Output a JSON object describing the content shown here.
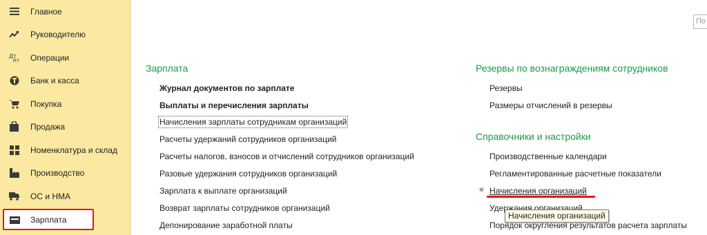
{
  "sidebar": {
    "items": [
      {
        "label": "Главное",
        "icon": "menu-lines-icon"
      },
      {
        "label": "Руководителю",
        "icon": "trend-line-icon"
      },
      {
        "label": "Операции",
        "icon": "debit-credit-icon"
      },
      {
        "label": "Банк и касса",
        "icon": "coin-icon"
      },
      {
        "label": "Покупка",
        "icon": "cart-icon"
      },
      {
        "label": "Продажа",
        "icon": "bag-icon"
      },
      {
        "label": "Номенклатура и склад",
        "icon": "grid-icon"
      },
      {
        "label": "Производство",
        "icon": "factory-icon"
      },
      {
        "label": "ОС и НМА",
        "icon": "truck-icon"
      },
      {
        "label": "Зарплата",
        "icon": "wallet-icon"
      }
    ],
    "active_index": 9
  },
  "search": {
    "placeholder": "По"
  },
  "salary": {
    "title": "Зарплата",
    "items": [
      "Журнал документов по зарплате",
      "Выплаты и перечисления зарплаты",
      "Начисления зарплаты сотрудникам организаций",
      "Расчеты удержаний сотрудников организаций",
      "Расчеты налогов, взносов и отчислений сотрудников организаций",
      "Разовые удержания сотрудников организаций",
      "Зарплата к выплате организаций",
      "Возврат зарплаты сотрудников организаций",
      "Депонирование заработной платы"
    ]
  },
  "reserves": {
    "title": "Резервы по вознаграждениям сотрудников",
    "items": [
      "Резервы",
      "Размеры отчислений в резервы"
    ]
  },
  "settings": {
    "title": "Справочники и настройки",
    "items": [
      "Производственные календари",
      "Регламентированные расчетные показатели",
      "Начисления организаций",
      "Удержания организаций",
      "Порядок округления результатов расчета зарплаты"
    ]
  },
  "tooltip": {
    "text": "Начисления организаций"
  },
  "colors": {
    "sidebar_bg": "#fbe9a1",
    "section_title": "#1a9b4a",
    "highlight": "#e8141c"
  }
}
